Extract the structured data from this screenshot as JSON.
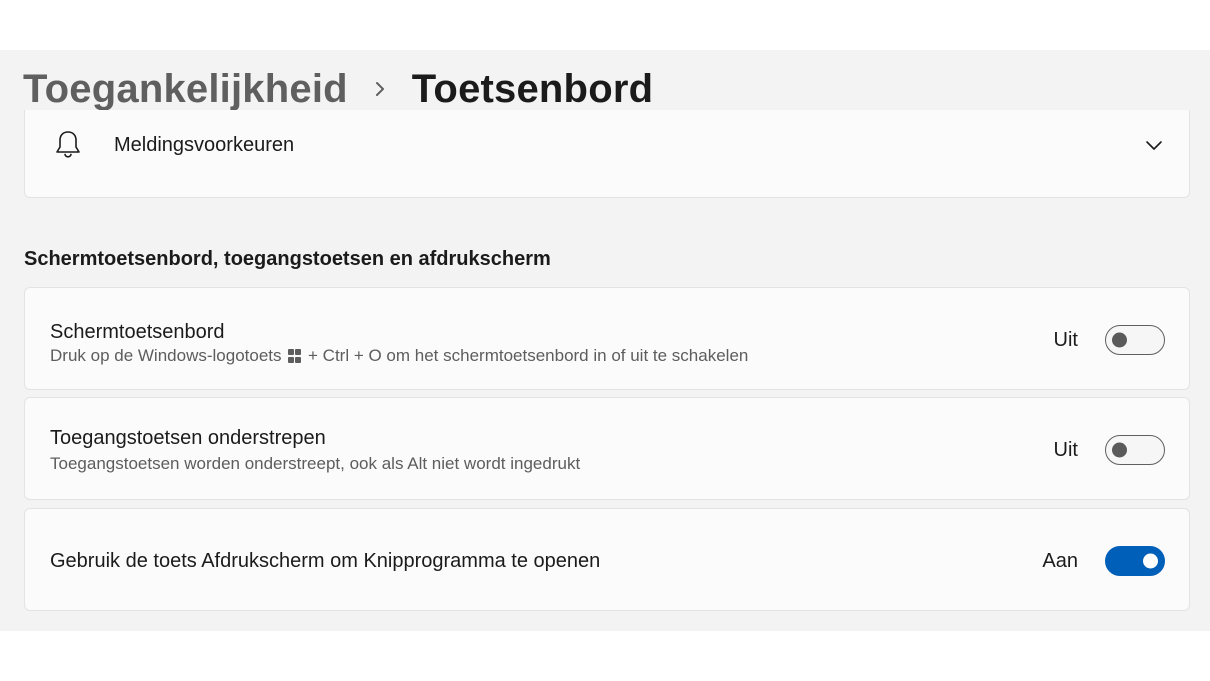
{
  "breadcrumb": {
    "parent": "Toegankelijkheid",
    "current": "Toetsenbord"
  },
  "notifications": {
    "label": "Meldingsvoorkeuren",
    "icon": "bell-icon"
  },
  "section": {
    "title": "Schermtoetsenbord, toegangstoetsen en afdrukscherm"
  },
  "settings": [
    {
      "title": "Schermtoetsenbord",
      "desc_before": "Druk op de Windows-logotoets",
      "desc_after": "+ Ctrl + O om het schermtoetsenbord in of uit te schakelen",
      "state": "Uit",
      "on": false
    },
    {
      "title": "Toegangstoetsen onderstrepen",
      "desc": "Toegangstoetsen worden onderstreept, ook als Alt niet wordt ingedrukt",
      "state": "Uit",
      "on": false
    },
    {
      "title": "Gebruik de toets Afdrukscherm om Knipprogramma te openen",
      "state": "Aan",
      "on": true
    }
  ],
  "colors": {
    "accent": "#005fb8",
    "background": "#f3f3f3",
    "card": "#fbfbfb"
  }
}
